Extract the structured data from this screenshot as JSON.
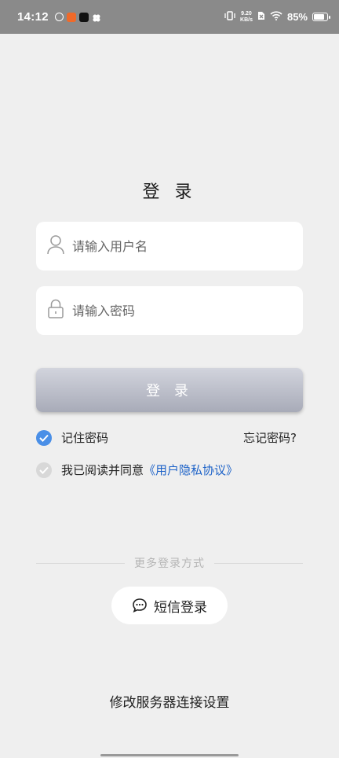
{
  "status_bar": {
    "time": "14:12",
    "net_speed_value": "9.20",
    "net_speed_unit": "KB/s",
    "battery_percent": "85%",
    "battery_level": 0.85
  },
  "login": {
    "title": "登 录",
    "username_placeholder": "请输入用户名",
    "password_placeholder": "请输入密码",
    "submit_label": "登 录",
    "remember_label": "记住密码",
    "remember_checked": true,
    "forgot_label": "忘记密码?",
    "agree_prefix": "我已阅读并同意",
    "agree_link": "《用户隐私协议》",
    "agree_checked": false
  },
  "more": {
    "divider_text": "更多登录方式",
    "sms_label": "短信登录"
  },
  "server_settings_label": "修改服务器连接设置",
  "colors": {
    "accent": "#4a8fe7",
    "link": "#1e63c8",
    "background": "#efefef"
  }
}
